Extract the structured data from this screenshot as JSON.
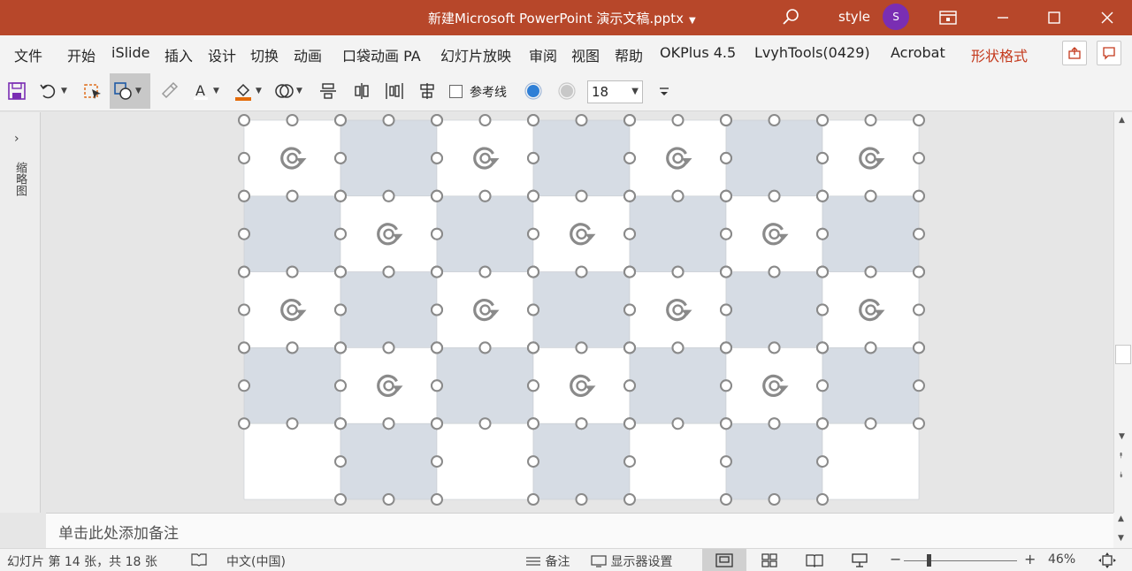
{
  "titlebar": {
    "title": "新建Microsoft PowerPoint 演示文稿.pptx",
    "user_name": "style",
    "avatar_initial": "S",
    "bg_color": "#b7472a",
    "avatar_color": "#7a2eb3"
  },
  "menu": {
    "tabs": [
      "文件",
      "开始",
      "iSlide",
      "插入",
      "设计",
      "切换",
      "动画",
      "口袋动画 PA",
      "幻灯片放映",
      "审阅",
      "视图",
      "帮助",
      "OKPlus 4.5",
      "LvyhTools(0429)",
      "Acrobat",
      "形状格式"
    ],
    "contextual_color": "#c4391c"
  },
  "toolbar": {
    "gridlines_label": "参考线",
    "font_size": "18",
    "icons": [
      "save-icon",
      "undo-icon",
      "select-icon",
      "shape-icon",
      "format-painter-icon",
      "font-color-icon",
      "fill-color-icon",
      "merge-shapes-icon",
      "align-top-icon",
      "align-middle-icon",
      "distribute-icon",
      "align-bottom-icon",
      "checkbox-icon",
      "theme-color-blue-icon",
      "theme-color-gray-icon",
      "customize-icon"
    ]
  },
  "leftpane": {
    "label": "缩略图"
  },
  "slide": {
    "rows": 5,
    "cols": 7,
    "cell_colors": [
      "#ffffff",
      "#d6dce4"
    ]
  },
  "notes": {
    "placeholder": "单击此处添加备注"
  },
  "status": {
    "slide_info": "幻灯片 第 14 张，共 18 张",
    "language": "中文(中国)",
    "notes_label": "备注",
    "display_settings_label": "显示器设置",
    "zoom_minus": "−",
    "zoom_plus": "+",
    "zoom_level": "46%"
  }
}
